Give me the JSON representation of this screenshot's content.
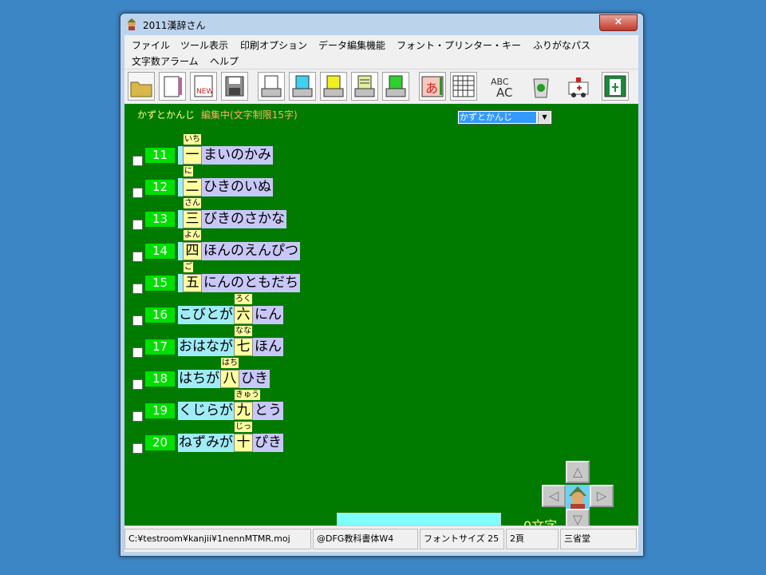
{
  "window": {
    "title": "2011漢辞さん",
    "close_label": "×"
  },
  "menu": [
    "ファイル",
    "ツール表示",
    "印刷オプション",
    "データ編集機能",
    "フォント・プリンター・キー",
    "ふりがなパス",
    "文字数アラーム",
    "ヘルプ"
  ],
  "header": {
    "title": "かずとかんじ",
    "edit_status": "編集中(文字制限15字)"
  },
  "dropdown": {
    "selected": "かずとかんじ"
  },
  "toolbar_icons": [
    "open-folder-icon",
    "new-page-icon",
    "new-document-icon",
    "save-disk-icon",
    "print-icon",
    "print-cyan-icon",
    "print-yellow-icon",
    "print-list-icon",
    "print-green-icon",
    "furigana-icon",
    "grid-icon",
    "spelling-icon",
    "recycle-bin-icon",
    "ambulance-icon",
    "exit-icon"
  ],
  "rows": [
    {
      "num": "11",
      "pre": "",
      "kanji": "一",
      "ruby": "いち",
      "post": "まいのかみ",
      "bar": true
    },
    {
      "num": "12",
      "pre": "",
      "kanji": "二",
      "ruby": "に",
      "post": "ひきのいぬ",
      "bar": true
    },
    {
      "num": "13",
      "pre": "",
      "kanji": "三",
      "ruby": "さん",
      "post": "びきのさかな",
      "bar": true
    },
    {
      "num": "14",
      "pre": "",
      "kanji": "四",
      "ruby": "よん",
      "post": "ほんのえんぴつ",
      "bar": true
    },
    {
      "num": "15",
      "pre": "",
      "kanji": "五",
      "ruby": "ご",
      "post": "にんのともだち",
      "bar": true
    },
    {
      "num": "16",
      "pre": "こびとが",
      "kanji": "六",
      "ruby": "ろく",
      "post": "にん",
      "bar": false
    },
    {
      "num": "17",
      "pre": "おはなが",
      "kanji": "七",
      "ruby": "なな",
      "post": "ほん",
      "bar": false
    },
    {
      "num": "18",
      "pre": "はちが",
      "kanji": "八",
      "ruby": "はち",
      "post": "ひき",
      "bar": false
    },
    {
      "num": "19",
      "pre": "くじらが",
      "kanji": "九",
      "ruby": "きゅう",
      "post": "とう",
      "bar": false
    },
    {
      "num": "20",
      "pre": "ねずみが",
      "kanji": "十",
      "ruby": "じっ",
      "post": "ぴき",
      "bar": false
    }
  ],
  "input": {
    "value": ""
  },
  "char_count": "0文字",
  "nav": {
    "up": "△",
    "down": "▽",
    "left": "◁",
    "right": "▷"
  },
  "status": {
    "path": "C:¥testroom¥kanjii¥1nennMTMR.moj",
    "font": "@DFG教科書体W4",
    "font_size": "フォントサイズ 25",
    "page": "2頁",
    "publisher": "三省堂"
  }
}
